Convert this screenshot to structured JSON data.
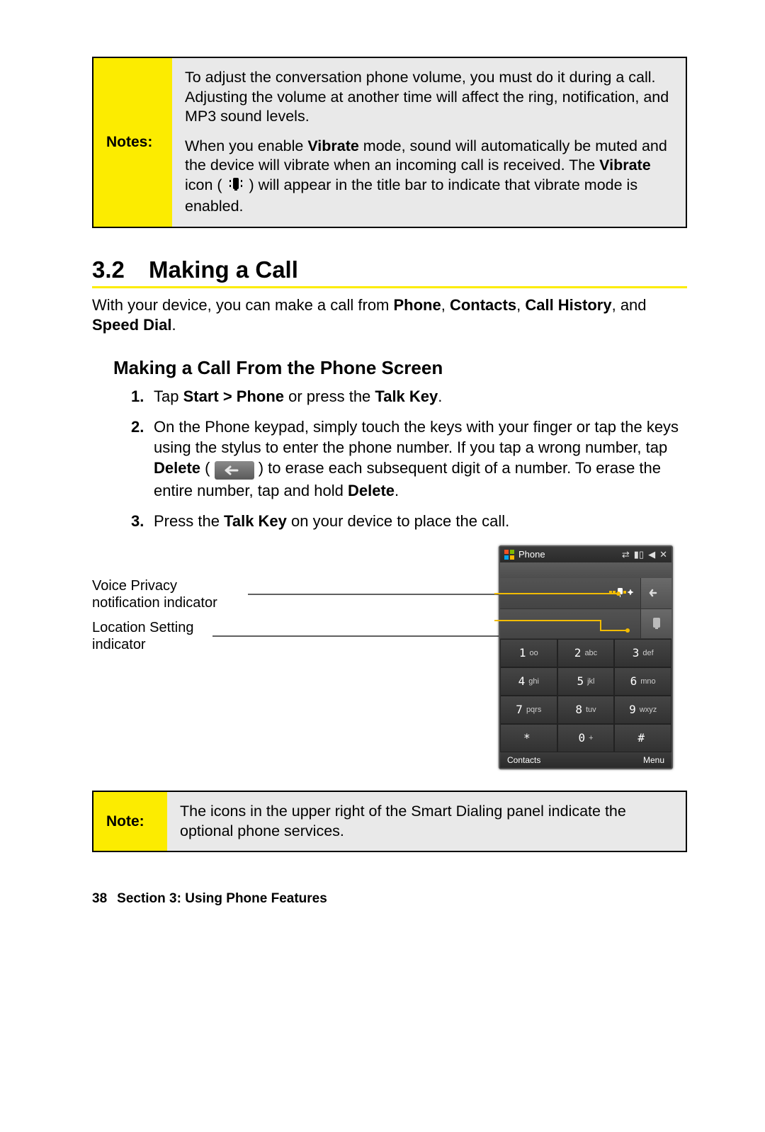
{
  "notes_box1": {
    "label": "Notes:",
    "para1": "To adjust the conversation phone volume, you must do it during a call. Adjusting the volume at another time will affect the ring, notification, and MP3 sound levels.",
    "para2_a": "When you enable ",
    "para2_vibrate": "Vibrate",
    "para2_b": " mode, sound will automatically be muted and the device will vibrate when an incoming call is received. The ",
    "para2_vibrate2": "Vibrate",
    "para2_c": " icon ( ",
    "para2_d": " ) will appear in the title bar to indicate that vibrate mode is enabled."
  },
  "section": {
    "number": "3.2",
    "title": "Making a Call",
    "intro_a": "With your device, you can make a call from ",
    "intro_phone": "Phone",
    "intro_s1": ", ",
    "intro_contacts": "Contacts",
    "intro_s2": ", ",
    "intro_callhist": "Call History",
    "intro_s3": ", and ",
    "intro_speed": "Speed Dial",
    "intro_end": "."
  },
  "subheading": "Making a Call From the Phone Screen",
  "steps": {
    "s1": {
      "num": "1.",
      "a": "Tap ",
      "b_start": "Start > Phone",
      "c": " or press the ",
      "b_talk": "Talk Key",
      "d": "."
    },
    "s2": {
      "num": "2.",
      "a": "On the Phone keypad, simply touch the keys with your finger or tap the keys using the stylus to enter the phone number. If you tap a wrong number, tap ",
      "b_delete": "Delete",
      "b_open": " ( ",
      "b_close": " ) to erase each subsequent digit of a number. To erase the entire number, tap and hold ",
      "b_delete2": "Delete",
      "d": "."
    },
    "s3": {
      "num": "3.",
      "a": "Press the ",
      "b_talk": "Talk Key",
      "c": " on your device to place the call."
    }
  },
  "callouts": {
    "c1": "Voice Privacy notification indicator",
    "c2": "Location Setting indicator"
  },
  "phone": {
    "title": "Phone",
    "contacts": "Contacts",
    "menu": "Menu",
    "keys": [
      {
        "n": "1",
        "s": "oo"
      },
      {
        "n": "2",
        "s": "abc"
      },
      {
        "n": "3",
        "s": "def"
      },
      {
        "n": "4",
        "s": "ghi"
      },
      {
        "n": "5",
        "s": "jkl"
      },
      {
        "n": "6",
        "s": "mno"
      },
      {
        "n": "7",
        "s": "pqrs"
      },
      {
        "n": "8",
        "s": "tuv"
      },
      {
        "n": "9",
        "s": "wxyz"
      },
      {
        "n": "*",
        "s": ""
      },
      {
        "n": "0",
        "s": "+"
      },
      {
        "n": "#",
        "s": ""
      }
    ]
  },
  "notes_box2": {
    "label": "Note:",
    "text": "The icons in the upper right of the Smart Dialing panel indicate the optional phone services."
  },
  "footer": {
    "page": "38",
    "section": "Section 3: Using Phone Features"
  }
}
